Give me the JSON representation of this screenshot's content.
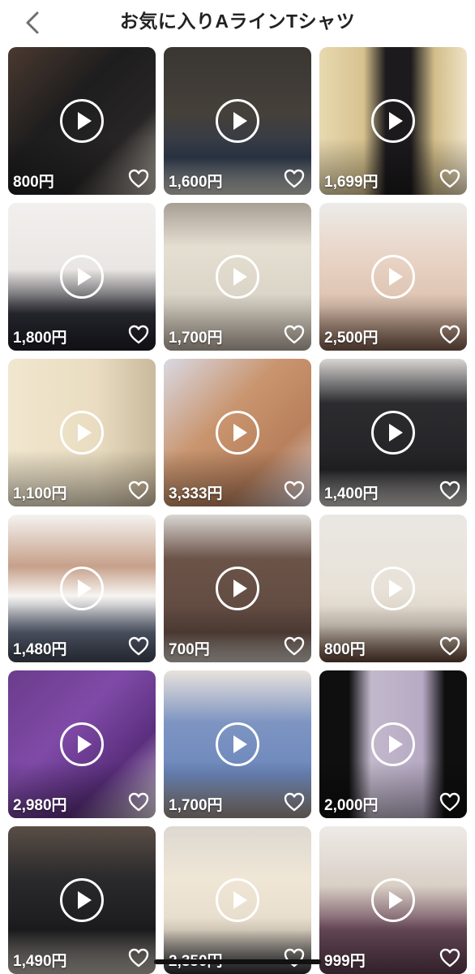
{
  "header": {
    "title": "お気に入りAラインTシャツ",
    "back_icon": "chevron-left-icon"
  },
  "items": [
    {
      "price": "800円",
      "bg": "linear-gradient(135deg,#4a3a30 0%,#1e1d1d 40%,#272525 70%,#b9b2a8 100%)"
    },
    {
      "price": "1,600円",
      "bg": "linear-gradient(180deg,#3a3632 0%,#45403a 45%,#2f3a4c 75%,#c9c6c0 100%)"
    },
    {
      "price": "1,699円",
      "bg": "linear-gradient(90deg,#e8d9b0 0%,#d7c28f 30%,#1c1a1c 45%,#1c1a1c 62%,#d2bd8a 78%,#eee3c6 100%)"
    },
    {
      "price": "1,800円",
      "bg": "linear-gradient(180deg,#f2f0ee 0%,#e9e6e3 45%,#2a2a33 75%,#1d1d26 100%)"
    },
    {
      "price": "1,700円",
      "bg": "linear-gradient(180deg,#a89f94 0%,#e5dfd2 30%,#d9d3c6 70%,#b8ada0 100%)"
    },
    {
      "price": "2,500円",
      "bg": "linear-gradient(180deg,#ecebe8 0%,#e8d2c3 40%,#dcc2b0 70%,#7a5a4a 100%)"
    },
    {
      "price": "1,100円",
      "bg": "linear-gradient(90deg,#f1e7cf 0%,#e9dcc0 60%,#c9b99c 100%)"
    },
    {
      "price": "3,333円",
      "bg": "linear-gradient(135deg,#d9d9e3 0%,#c9956f 40%,#b8805c 70%,#dcd6df 100%)"
    },
    {
      "price": "1,400円",
      "bg": "linear-gradient(180deg,#d8d6d4 0%,#2c2c2f 30%,#232326 75%,#c6c3c0 100%)"
    },
    {
      "price": "1,480円",
      "bg": "linear-gradient(180deg,#f5f3f0 0%,#c6a08a 35%,#f7f5f2 55%,#5a6274 80%,#404656 100%)"
    },
    {
      "price": "700円",
      "bg": "linear-gradient(180deg,#d9d6d2 0%,#6b5348 30%,#5e483f 80%,#c8c2bc 100%)"
    },
    {
      "price": "800円",
      "bg": "linear-gradient(180deg,#eae7e3 0%,#e8e2d8 50%,#d8cfc3 75%,#5e4032 100%)"
    },
    {
      "price": "2,980円",
      "bg": "linear-gradient(135deg,#6b3c8c 0%,#7f4aa7 40%,#5b2f7e 70%,#d6cfd8 100%)"
    },
    {
      "price": "1,700円",
      "bg": "linear-gradient(180deg,#e8e2dc 0%,#7e95c2 35%,#6d88bd 70%,#9a8e86 100%)"
    },
    {
      "price": "2,000円",
      "bg": "linear-gradient(90deg,#0f0f10 0%,#0f0f10 20%,#c2b8cb 35%,#b7aac4 70%,#0f0f10 85%)"
    },
    {
      "price": "1,490円",
      "bg": "linear-gradient(180deg,#5a4e46 0%,#2a2a2c 35%,#1c1c1e 70%,#b5aea6 100%)"
    },
    {
      "price": "2,350円",
      "bg": "linear-gradient(180deg,#ddd8d1 0%,#efe6d6 35%,#e6dccb 70%,#2a2a30 100%)"
    },
    {
      "price": "999円",
      "bg": "linear-gradient(180deg,#eeeae6 0%,#d9d0c6 40%,#6c4c5c 70%,#5a3c4c 100%)"
    }
  ],
  "icons": {
    "play": "play-icon",
    "favorite": "heart-icon"
  }
}
